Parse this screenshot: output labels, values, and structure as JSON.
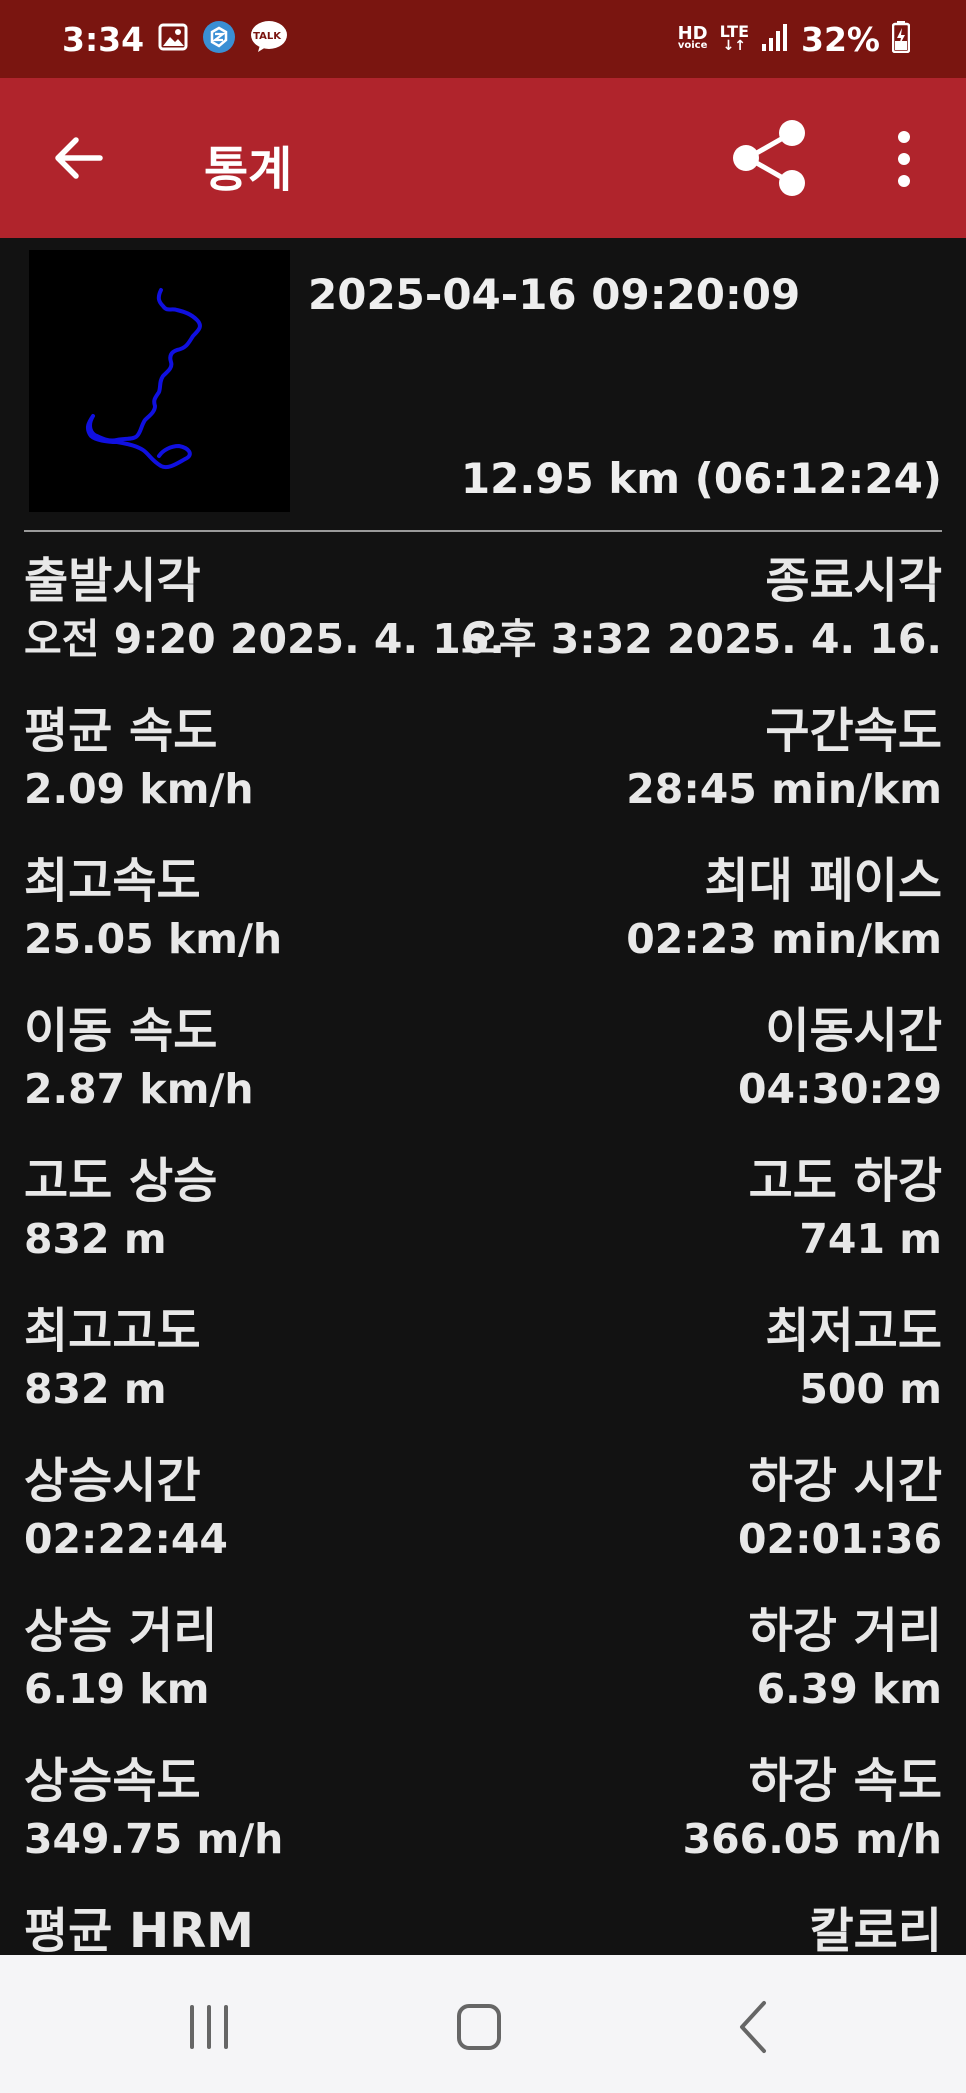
{
  "status_bar": {
    "time": "3:34",
    "talk_badge": "TALK",
    "hd_line1": "HD",
    "hd_line2": "voice",
    "lte": "LTE",
    "battery": "32%"
  },
  "app_bar": {
    "title": "통계"
  },
  "track": {
    "date": "2025-04-16 09:20:09",
    "summary": "12.95 km (06:12:24)",
    "line_color": "#1010e0"
  },
  "stats": [
    {
      "left_label": "출발시각",
      "left_value": "오전 9:20 2025. 4. 16.",
      "right_label": "종료시각",
      "right_value": "오후 3:32 2025. 4. 16."
    },
    {
      "left_label": "평균 속도",
      "left_value": "2.09 km/h",
      "right_label": "구간속도",
      "right_value": "28:45 min/km"
    },
    {
      "left_label": "최고속도",
      "left_value": "25.05 km/h",
      "right_label": "최대 페이스",
      "right_value": "02:23 min/km"
    },
    {
      "left_label": "이동 속도",
      "left_value": "2.87 km/h",
      "right_label": "이동시간",
      "right_value": "04:30:29"
    },
    {
      "left_label": "고도 상승",
      "left_value": "832 m",
      "right_label": "고도 하강",
      "right_value": "741 m"
    },
    {
      "left_label": "최고고도",
      "left_value": "832 m",
      "right_label": "최저고도",
      "right_value": "500 m"
    },
    {
      "left_label": "상승시간",
      "left_value": "02:22:44",
      "right_label": "하강 시간",
      "right_value": "02:01:36"
    },
    {
      "left_label": "상승 거리",
      "left_value": "6.19 km",
      "right_label": "하강 거리",
      "right_value": "6.39 km"
    },
    {
      "left_label": "상승속도",
      "left_value": "349.75 m/h",
      "right_label": "하강 속도",
      "right_value": "366.05 m/h"
    },
    {
      "left_label": "평균 HRM",
      "left_value": "",
      "right_label": "칼로리",
      "right_value": ""
    }
  ],
  "colors": {
    "status_bar": "#7a1510",
    "app_bar": "#b0242c",
    "background": "#121212",
    "nav_bar": "#f5f5f7"
  }
}
